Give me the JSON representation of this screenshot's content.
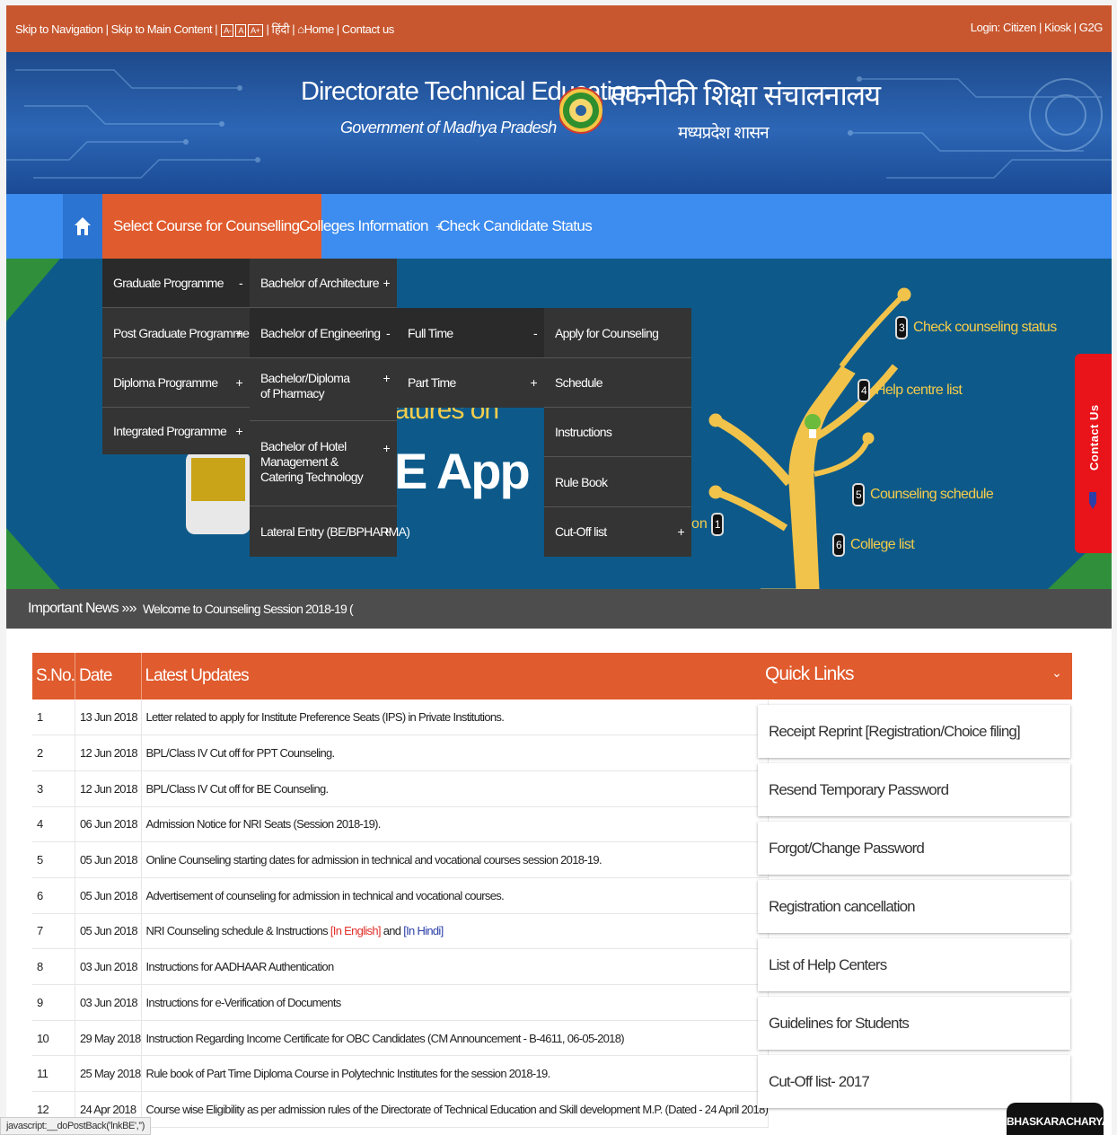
{
  "topbar": {
    "skip_nav": "Skip to Navigation",
    "skip_main": "Skip to Main Content",
    "font_small": "A-",
    "font_normal": "A",
    "font_large": "A+",
    "hindi": "हिंदी",
    "home": "Home",
    "contact": "Contact us",
    "login_label": "Login:",
    "login_citizen": "Citizen",
    "login_kiosk": "Kiosk",
    "login_g2g": "G2G"
  },
  "header": {
    "title_en": "Directorate Technical Education",
    "subtitle_en": "Government of Madhya Pradesh",
    "title_hi": "तकनीकी शिक्षा संचालनालय",
    "subtitle_hi": "मध्यप्रदेश शासन"
  },
  "nav": {
    "items": [
      {
        "label": "Select Course for Counselling",
        "toggle": "-"
      },
      {
        "label": "Colleges Information",
        "toggle": "+"
      },
      {
        "label": "Check Candidate Status"
      }
    ]
  },
  "menu1": [
    {
      "label": "Graduate Programme",
      "toggle": "-"
    },
    {
      "label": "Post Graduate Programme",
      "toggle": "+"
    },
    {
      "label": "Diploma Programme",
      "toggle": "+"
    },
    {
      "label": "Integrated Programme",
      "toggle": "+"
    }
  ],
  "menu2": [
    {
      "label": "Bachelor of Architecture",
      "toggle": "+"
    },
    {
      "label": "Bachelor of Engineering",
      "toggle": "-"
    },
    {
      "label": "Bachelor/Diploma of Pharmacy",
      "toggle": "+"
    },
    {
      "label": "Bachelor of Hotel Management & Catering Technology",
      "toggle": "+"
    },
    {
      "label": "Lateral Entry (BE/BPHARMA)",
      "toggle": "+"
    }
  ],
  "menu3": [
    {
      "label": "Full Time",
      "toggle": "-"
    },
    {
      "label": "Part Time",
      "toggle": "+"
    }
  ],
  "menu4": [
    {
      "label": "Apply for Counseling"
    },
    {
      "label": "Schedule"
    },
    {
      "label": "Instructions"
    },
    {
      "label": "Rule Book"
    },
    {
      "label": "Cut-Off list",
      "toggle": "+"
    }
  ],
  "banner": {
    "features_fragment": "atures on",
    "app_fragment": "E App",
    "on_fragment": "on",
    "tree_items": [
      {
        "num": "3",
        "label": "Check counseling status"
      },
      {
        "num": "4",
        "label": "Help centre list"
      },
      {
        "num": "5",
        "label": "Counseling schedule"
      },
      {
        "num": "6",
        "label": "College list"
      }
    ],
    "hidden_num": "1",
    "contact_tab": "Contact Us"
  },
  "news": {
    "label": "Important News »»",
    "message": "Welcome to Counseling Session 2018-19 ("
  },
  "updates": {
    "headers": [
      "S.No.",
      "Date",
      "Latest Updates"
    ],
    "rows": [
      {
        "no": "1",
        "date": "13 Jun 2018",
        "text": "Letter related to apply for Institute Preference Seats (IPS) in Private Institutions."
      },
      {
        "no": "2",
        "date": "12 Jun 2018",
        "text": "BPL/Class IV Cut off for PPT Counseling."
      },
      {
        "no": "3",
        "date": "12 Jun 2018",
        "text": "BPL/Class IV Cut off for BE Counseling."
      },
      {
        "no": "4",
        "date": "06 Jun 2018",
        "text": "Admission Notice for NRI Seats (Session 2018-19)."
      },
      {
        "no": "5",
        "date": "05 Jun 2018",
        "text": "Online Counseling starting dates for admission in technical and vocational courses session 2018-19."
      },
      {
        "no": "6",
        "date": "05 Jun 2018",
        "text": "Advertisement of counseling for admission in technical and vocational courses."
      },
      {
        "no": "7",
        "date": "05 Jun 2018",
        "text": "NRI Counseling schedule & Instructions ",
        "link1": "[In English]",
        "mid": " and ",
        "link2": "[In Hindi]"
      },
      {
        "no": "8",
        "date": "03 Jun 2018",
        "text": "Instructions for AADHAAR Authentication"
      },
      {
        "no": "9",
        "date": "03 Jun 2018",
        "text": "Instructions for e-Verification of Documents"
      },
      {
        "no": "10",
        "date": "29 May 2018",
        "text": "Instruction Regarding Income Certificate for OBC Candidates (CM Announcement - B-4611, 06-05-2018)"
      },
      {
        "no": "11",
        "date": "25 May 2018",
        "text": "Rule book of Part Time Diploma Course in Polytechnic Institutes for the session 2018-19."
      },
      {
        "no": "12",
        "date": "24 Apr 2018",
        "text": "Course wise Eligibility as per admission rules of the Directorate of Technical Education and Skill development M.P. (Dated - 24 April 2018)"
      }
    ]
  },
  "quick_links": {
    "title": "Quick Links",
    "items": [
      "Receipt Reprint [Registration/Choice filing]",
      "Resend Temporary Password",
      "Forgot/Change Password",
      "Registration cancellation",
      "List of Help Centers",
      "Guidelines for Students",
      "Cut-Off list- 2017"
    ]
  },
  "status_bar": "javascript:__doPostBack('lnkBE','')",
  "badge": "BHASKARACHARYA",
  "colors": {
    "primary_orange": "#e05b2d",
    "nav_blue": "#3d8cef",
    "topbar": "#c8572f",
    "dropdown": "#343434"
  }
}
